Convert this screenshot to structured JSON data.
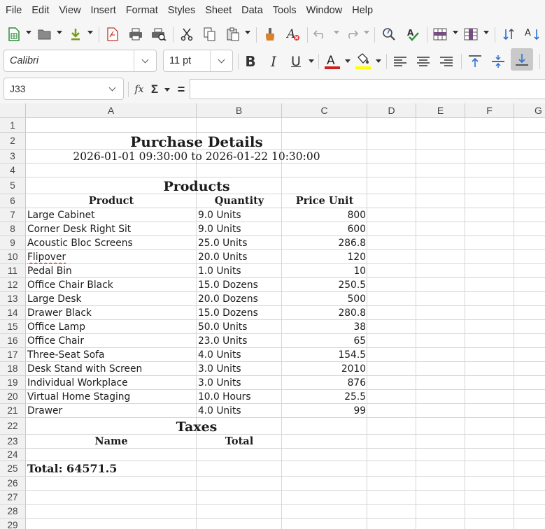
{
  "menu": [
    "File",
    "Edit",
    "View",
    "Insert",
    "Format",
    "Styles",
    "Sheet",
    "Data",
    "Tools",
    "Window",
    "Help"
  ],
  "format_bar": {
    "font_name": "Calibri",
    "font_size": "11 pt",
    "bold": "B",
    "italic": "I",
    "underline": "U",
    "font_color": "#c9211e",
    "highlight_color": "#ffff00"
  },
  "formula_bar": {
    "cell_ref": "J33",
    "function_wizard": "fx",
    "sum": "Σ",
    "equals": "=",
    "formula": ""
  },
  "columns": [
    "A",
    "B",
    "C",
    "D",
    "E",
    "F",
    "G"
  ],
  "rows": [
    "1",
    "2",
    "3",
    "4",
    "5",
    "6",
    "7",
    "8",
    "9",
    "10",
    "11",
    "12",
    "13",
    "14",
    "15",
    "16",
    "17",
    "18",
    "19",
    "20",
    "21",
    "22",
    "23",
    "24",
    "25",
    "26",
    "27",
    "28",
    "29"
  ],
  "sheet": {
    "title": "Purchase Details",
    "date_range": "2026-01-01 09:30:00 to 2026-01-22 10:30:00",
    "products_heading": "Products",
    "headers": {
      "product": "Product",
      "quantity": "Quantity",
      "price_unit": "Price Unit"
    },
    "products": [
      {
        "name": "Large Cabinet",
        "quantity": "9.0 Units",
        "price": "800"
      },
      {
        "name": "Corner Desk Right Sit",
        "quantity": "9.0 Units",
        "price": "600"
      },
      {
        "name": "Acoustic Bloc Screens",
        "quantity": "25.0 Units",
        "price": "286.8"
      },
      {
        "name": "Flipover",
        "quantity": "20.0 Units",
        "price": "120"
      },
      {
        "name": "Pedal Bin",
        "quantity": "1.0 Units",
        "price": "10"
      },
      {
        "name": "Office Chair Black",
        "quantity": "15.0 Dozens",
        "price": "250.5"
      },
      {
        "name": "Large Desk",
        "quantity": "20.0 Dozens",
        "price": "500"
      },
      {
        "name": "Drawer Black",
        "quantity": "15.0 Dozens",
        "price": "280.8"
      },
      {
        "name": "Office Lamp",
        "quantity": "50.0 Units",
        "price": "38"
      },
      {
        "name": "Office Chair",
        "quantity": "23.0 Units",
        "price": "65"
      },
      {
        "name": "Three-Seat Sofa",
        "quantity": "4.0 Units",
        "price": "154.5"
      },
      {
        "name": "Desk Stand with Screen",
        "quantity": "3.0 Units",
        "price": "2010"
      },
      {
        "name": "Individual Workplace",
        "quantity": "3.0 Units",
        "price": "876"
      },
      {
        "name": "Virtual Home Staging",
        "quantity": "10.0 Hours",
        "price": "25.5"
      },
      {
        "name": "Drawer",
        "quantity": "4.0 Units",
        "price": "99"
      }
    ],
    "taxes_heading": "Taxes",
    "tax_headers": {
      "name": "Name",
      "total": "Total"
    },
    "total": "Total: 64571.5"
  }
}
